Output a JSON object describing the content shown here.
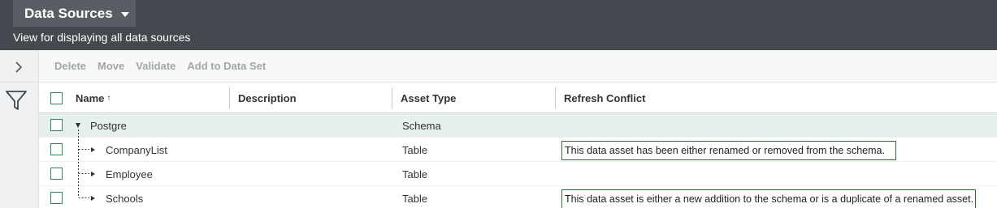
{
  "header": {
    "title": "Data Sources",
    "subtitle": "View for displaying all data sources"
  },
  "toolbar": {
    "delete_label": "Delete",
    "move_label": "Move",
    "validate_label": "Validate",
    "add_to_data_set_label": "Add to Data Set"
  },
  "table": {
    "columns": {
      "name": "Name",
      "description": "Description",
      "asset_type": "Asset Type",
      "refresh_conflict": "Refresh Conflict"
    },
    "sort_indicator": "↑",
    "rows": [
      {
        "name": "Postgre",
        "description": "",
        "asset_type": "Schema",
        "refresh_conflict": ""
      },
      {
        "name": "CompanyList",
        "description": "",
        "asset_type": "Table",
        "refresh_conflict": "This data asset has been either renamed or removed from the schema."
      },
      {
        "name": "Employee",
        "description": "",
        "asset_type": "Table",
        "refresh_conflict": ""
      },
      {
        "name": "Schools",
        "description": "",
        "asset_type": "Table",
        "refresh_conflict": "This data asset is either a new addition to the schema or is a duplicate of a renamed asset."
      }
    ]
  },
  "colors": {
    "header_bg": "#45494f",
    "checkbox_accent": "#2e8b57",
    "conflict_border": "#2f6e2f",
    "selected_row_bg": "#e7efed"
  },
  "icons": {
    "dropdown": "chevron-down-icon",
    "expand": "chevron-right-icon",
    "filter": "filter-icon"
  }
}
